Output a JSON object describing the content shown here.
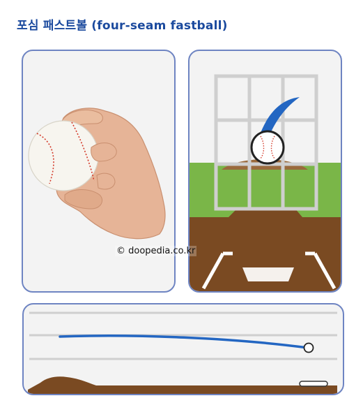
{
  "title": "포심 패스트볼 (four-seam fastball)",
  "copyright": "© doopedia.co.kr",
  "colors": {
    "title": "#1b4a9e",
    "panel_border": "#6e84c2",
    "panel_background": "#f3f3f3",
    "grass": "#7ab648",
    "dirt": "#7a4a22",
    "ball_track": "#2366c2"
  },
  "panels": {
    "grip": {
      "content": "hand holding a baseball in a four-seam grip"
    },
    "strike_zone": {
      "content": "catcher view: ball crossing the strike zone grid with a rising blue trail"
    },
    "side_view": {
      "content": "side view: straight blue trajectory from mound to plate"
    }
  }
}
